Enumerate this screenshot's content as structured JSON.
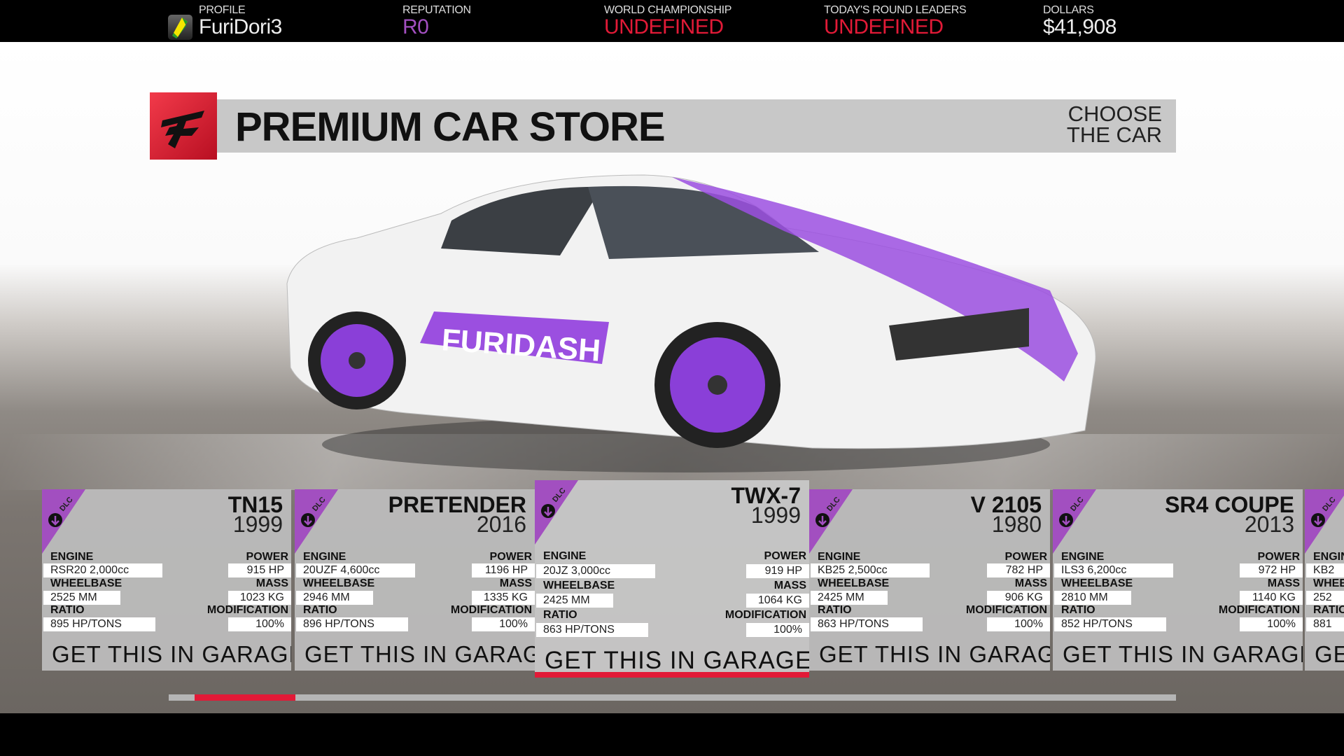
{
  "header": {
    "profile": {
      "label": "PROFILE",
      "value": "FuriDori3",
      "icon": "beginner-leaf-icon"
    },
    "reputation": {
      "label": "REPUTATION",
      "value": "R0",
      "color": "#a24fc0"
    },
    "world_championship": {
      "label": "WORLD CHAMPIONSHIP",
      "value": "UNDEFINED",
      "color": "#e21a37"
    },
    "round_leaders": {
      "label": "TODAY'S ROUND LEADERS",
      "value": "UNDEFINED",
      "color": "#e21a37"
    },
    "dollars": {
      "label": "DOLLARS",
      "value": "$41,908"
    }
  },
  "banner": {
    "title": "PREMIUM CAR STORE",
    "subtitle_line1": "CHOOSE",
    "subtitle_line2": "THE CAR"
  },
  "colors": {
    "accent": "#e21a37",
    "dlc": "#a24fc0"
  },
  "labels": {
    "engine": "ENGINE",
    "power": "POWER",
    "wheelbase": "WHEELBASE",
    "mass": "MASS",
    "ratio": "RATIO",
    "modification": "MODIFICATION",
    "action": "GET THIS IN GARAGE",
    "dlc": "DLC"
  },
  "cars": [
    {
      "name": "TN15",
      "year": "1999",
      "engine": "RSR20 2,000cc",
      "power": "915 HP",
      "wheelbase": "2525 MM",
      "mass": "1023 KG",
      "ratio": "895 HP/TONS",
      "modification": "100%"
    },
    {
      "name": "PRETENDER",
      "year": "2016",
      "engine": "20UZF 4,600cc",
      "power": "1196 HP",
      "wheelbase": "2946 MM",
      "mass": "1335 KG",
      "ratio": "896 HP/TONS",
      "modification": "100%"
    },
    {
      "name": "TWX-7",
      "year": "1999",
      "engine": "20JZ 3,000cc",
      "power": "919 HP",
      "wheelbase": "2425 MM",
      "mass": "1064 KG",
      "ratio": "863 HP/TONS",
      "modification": "100%",
      "selected": true
    },
    {
      "name": "V 2105",
      "year": "1980",
      "engine": "KB25 2,500cc",
      "power": "782 HP",
      "wheelbase": "2425 MM",
      "mass": "906 KG",
      "ratio": "863 HP/TONS",
      "modification": "100%"
    },
    {
      "name": "SR4 COUPE",
      "year": "2013",
      "engine": "ILS3 6,200cc",
      "power": "972 HP",
      "wheelbase": "2810 MM",
      "mass": "1140 KG",
      "ratio": "852 HP/TONS",
      "modification": "100%"
    },
    {
      "engine": "KB2",
      "wheelbase": "252",
      "ratio": "881"
    }
  ],
  "scroll": {
    "position_fraction": 0.03,
    "visible_fraction": 0.1
  }
}
